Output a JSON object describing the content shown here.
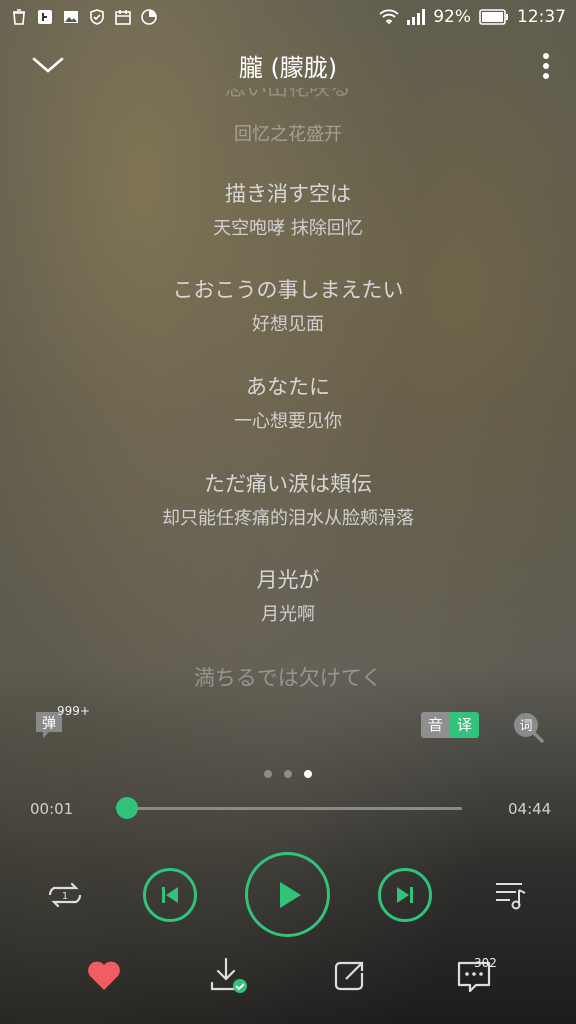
{
  "status_bar": {
    "battery": "92%",
    "time": "12:37"
  },
  "header": {
    "title": "朧 (朦胧)"
  },
  "lyrics": [
    {
      "jp": "",
      "cn": "回忆之花盛开"
    },
    {
      "jp": "描き消す空は",
      "cn": "天空咆哮 抹除回忆"
    },
    {
      "jp": "こおこうの事しまえたい",
      "cn": "好想见面"
    },
    {
      "jp": "あなたに",
      "cn": "一心想要见你"
    },
    {
      "jp": "ただ痛い涙は頬伝",
      "cn": "却只能任疼痛的泪水从脸颊滑落"
    },
    {
      "jp": "月光が",
      "cn": "月光啊"
    },
    {
      "jp": "満ちるでは欠けてく",
      "cn": ""
    }
  ],
  "controls": {
    "danmu_label": "弹",
    "danmu_count": "999+",
    "yin_label": "音",
    "yi_label": "译",
    "ci_label": "词"
  },
  "page_indicator": {
    "count": 3,
    "active": 3
  },
  "progress": {
    "current": "00:01",
    "total": "04:44",
    "fraction": 0.004
  },
  "bottom": {
    "comment_count": "302"
  },
  "colors": {
    "accent": "#31c27c",
    "like": "#f25c63"
  }
}
